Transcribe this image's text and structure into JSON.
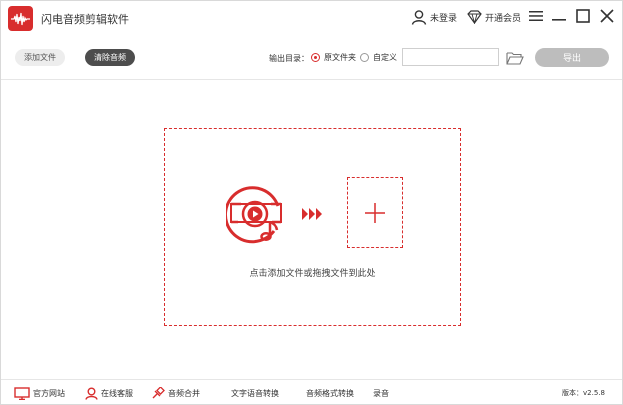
{
  "app": {
    "title": "闪电音频剪辑软件"
  },
  "titlebar": {
    "login_label": "未登录",
    "vip_label": "开通会员"
  },
  "toolbar": {
    "add_file_label": "添加文件",
    "clear_label": "清除音频",
    "output_dir_label": "输出目录：",
    "radio_source_label": "原文件夹",
    "radio_custom_label": "自定义",
    "path_value": "",
    "export_label": "导出"
  },
  "dropzone": {
    "hint": "点击添加文件或拖拽文件到此处"
  },
  "footer": {
    "items": [
      "官方网站",
      "在线客服",
      "音频合并",
      "文字语音转换",
      "音频格式转换",
      "录音"
    ],
    "version": "版本：v2.5.8"
  },
  "colors": {
    "accent": "#d82d2d",
    "disabled": "#bdbdbd",
    "dark_button": "#4d4d4d"
  },
  "icons": {
    "logo": "waveform-icon",
    "user": "user-icon",
    "vip": "diamond-icon",
    "menu": "menu-icon",
    "minimize": "minimize-icon",
    "maximize": "maximize-icon",
    "close": "close-icon",
    "folder": "folder-icon",
    "music": "music-file-icon",
    "arrows": "forward-arrows-icon",
    "add": "plus-icon",
    "website": "monitor-icon",
    "support": "headset-icon",
    "merge": "merge-icon"
  }
}
